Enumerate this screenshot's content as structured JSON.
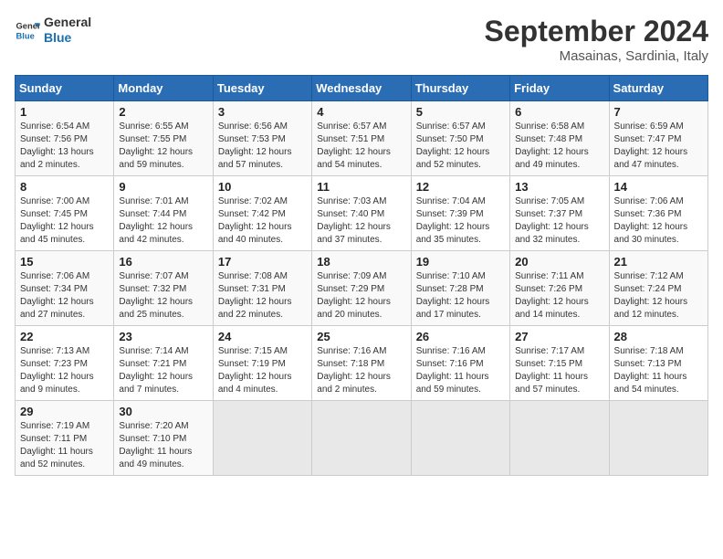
{
  "logo": {
    "line1": "General",
    "line2": "Blue"
  },
  "title": "September 2024",
  "subtitle": "Masainas, Sardinia, Italy",
  "days_of_week": [
    "Sunday",
    "Monday",
    "Tuesday",
    "Wednesday",
    "Thursday",
    "Friday",
    "Saturday"
  ],
  "weeks": [
    [
      {
        "day": "1",
        "info": "Sunrise: 6:54 AM\nSunset: 7:56 PM\nDaylight: 13 hours\nand 2 minutes."
      },
      {
        "day": "2",
        "info": "Sunrise: 6:55 AM\nSunset: 7:55 PM\nDaylight: 12 hours\nand 59 minutes."
      },
      {
        "day": "3",
        "info": "Sunrise: 6:56 AM\nSunset: 7:53 PM\nDaylight: 12 hours\nand 57 minutes."
      },
      {
        "day": "4",
        "info": "Sunrise: 6:57 AM\nSunset: 7:51 PM\nDaylight: 12 hours\nand 54 minutes."
      },
      {
        "day": "5",
        "info": "Sunrise: 6:57 AM\nSunset: 7:50 PM\nDaylight: 12 hours\nand 52 minutes."
      },
      {
        "day": "6",
        "info": "Sunrise: 6:58 AM\nSunset: 7:48 PM\nDaylight: 12 hours\nand 49 minutes."
      },
      {
        "day": "7",
        "info": "Sunrise: 6:59 AM\nSunset: 7:47 PM\nDaylight: 12 hours\nand 47 minutes."
      }
    ],
    [
      {
        "day": "8",
        "info": "Sunrise: 7:00 AM\nSunset: 7:45 PM\nDaylight: 12 hours\nand 45 minutes."
      },
      {
        "day": "9",
        "info": "Sunrise: 7:01 AM\nSunset: 7:44 PM\nDaylight: 12 hours\nand 42 minutes."
      },
      {
        "day": "10",
        "info": "Sunrise: 7:02 AM\nSunset: 7:42 PM\nDaylight: 12 hours\nand 40 minutes."
      },
      {
        "day": "11",
        "info": "Sunrise: 7:03 AM\nSunset: 7:40 PM\nDaylight: 12 hours\nand 37 minutes."
      },
      {
        "day": "12",
        "info": "Sunrise: 7:04 AM\nSunset: 7:39 PM\nDaylight: 12 hours\nand 35 minutes."
      },
      {
        "day": "13",
        "info": "Sunrise: 7:05 AM\nSunset: 7:37 PM\nDaylight: 12 hours\nand 32 minutes."
      },
      {
        "day": "14",
        "info": "Sunrise: 7:06 AM\nSunset: 7:36 PM\nDaylight: 12 hours\nand 30 minutes."
      }
    ],
    [
      {
        "day": "15",
        "info": "Sunrise: 7:06 AM\nSunset: 7:34 PM\nDaylight: 12 hours\nand 27 minutes."
      },
      {
        "day": "16",
        "info": "Sunrise: 7:07 AM\nSunset: 7:32 PM\nDaylight: 12 hours\nand 25 minutes."
      },
      {
        "day": "17",
        "info": "Sunrise: 7:08 AM\nSunset: 7:31 PM\nDaylight: 12 hours\nand 22 minutes."
      },
      {
        "day": "18",
        "info": "Sunrise: 7:09 AM\nSunset: 7:29 PM\nDaylight: 12 hours\nand 20 minutes."
      },
      {
        "day": "19",
        "info": "Sunrise: 7:10 AM\nSunset: 7:28 PM\nDaylight: 12 hours\nand 17 minutes."
      },
      {
        "day": "20",
        "info": "Sunrise: 7:11 AM\nSunset: 7:26 PM\nDaylight: 12 hours\nand 14 minutes."
      },
      {
        "day": "21",
        "info": "Sunrise: 7:12 AM\nSunset: 7:24 PM\nDaylight: 12 hours\nand 12 minutes."
      }
    ],
    [
      {
        "day": "22",
        "info": "Sunrise: 7:13 AM\nSunset: 7:23 PM\nDaylight: 12 hours\nand 9 minutes."
      },
      {
        "day": "23",
        "info": "Sunrise: 7:14 AM\nSunset: 7:21 PM\nDaylight: 12 hours\nand 7 minutes."
      },
      {
        "day": "24",
        "info": "Sunrise: 7:15 AM\nSunset: 7:19 PM\nDaylight: 12 hours\nand 4 minutes."
      },
      {
        "day": "25",
        "info": "Sunrise: 7:16 AM\nSunset: 7:18 PM\nDaylight: 12 hours\nand 2 minutes."
      },
      {
        "day": "26",
        "info": "Sunrise: 7:16 AM\nSunset: 7:16 PM\nDaylight: 11 hours\nand 59 minutes."
      },
      {
        "day": "27",
        "info": "Sunrise: 7:17 AM\nSunset: 7:15 PM\nDaylight: 11 hours\nand 57 minutes."
      },
      {
        "day": "28",
        "info": "Sunrise: 7:18 AM\nSunset: 7:13 PM\nDaylight: 11 hours\nand 54 minutes."
      }
    ],
    [
      {
        "day": "29",
        "info": "Sunrise: 7:19 AM\nSunset: 7:11 PM\nDaylight: 11 hours\nand 52 minutes."
      },
      {
        "day": "30",
        "info": "Sunrise: 7:20 AM\nSunset: 7:10 PM\nDaylight: 11 hours\nand 49 minutes."
      },
      {
        "day": "",
        "info": ""
      },
      {
        "day": "",
        "info": ""
      },
      {
        "day": "",
        "info": ""
      },
      {
        "day": "",
        "info": ""
      },
      {
        "day": "",
        "info": ""
      }
    ]
  ]
}
